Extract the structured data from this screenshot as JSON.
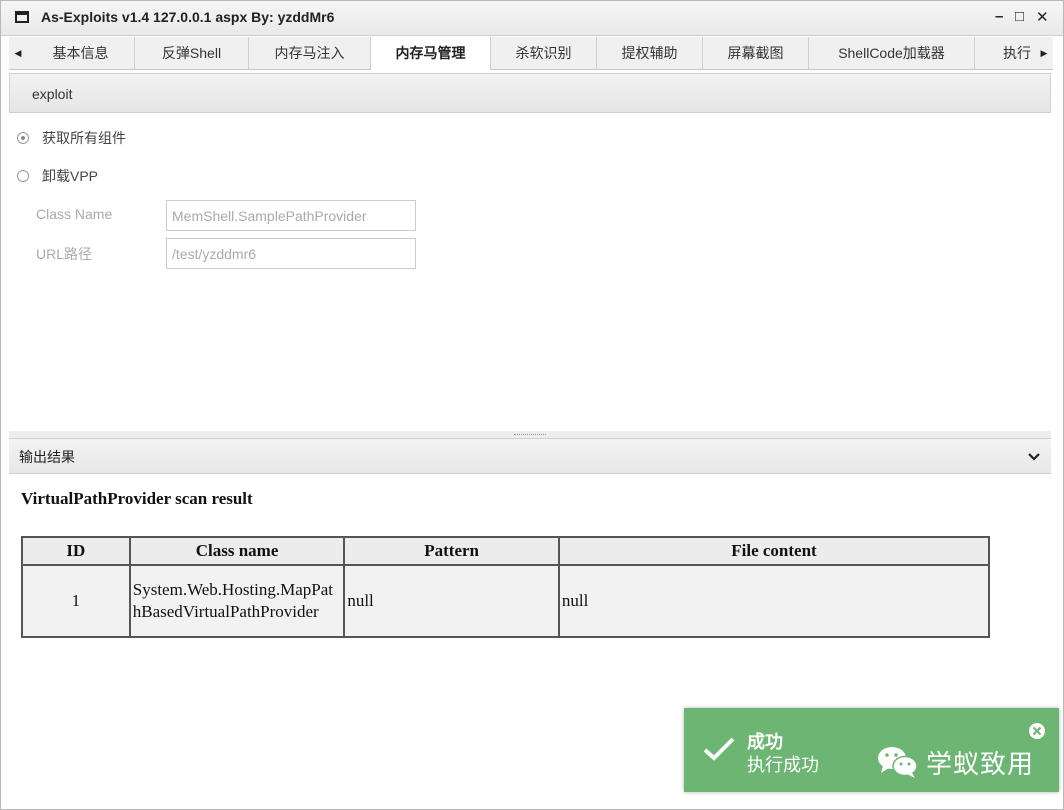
{
  "window": {
    "title": "As-Exploits v1.4 127.0.0.1 aspx By: yzddMr6",
    "minimize": "–",
    "maximize": "□",
    "close": "✕"
  },
  "tabs": [
    {
      "label": "基本信息"
    },
    {
      "label": "反弹Shell"
    },
    {
      "label": "内存马注入"
    },
    {
      "label": "内存马管理",
      "active": true
    },
    {
      "label": "杀软识别"
    },
    {
      "label": "提权辅助"
    },
    {
      "label": "屏幕截图"
    },
    {
      "label": "ShellCode加载器"
    },
    {
      "label": "执行"
    }
  ],
  "subbar": {
    "label": "exploit"
  },
  "options": {
    "get_all": "获取所有组件",
    "unload": "卸载VPP",
    "selected": "get_all"
  },
  "fields": {
    "class_name_label": "Class Name",
    "class_name_value": "MemShell.SamplePathProvider",
    "url_label": "URL路径",
    "url_value": "/test/yzddmr6"
  },
  "output": {
    "title": "输出结果",
    "scan_title": "VirtualPathProvider scan result",
    "columns": [
      "ID",
      "Class name",
      "Pattern",
      "File content"
    ],
    "rows": [
      [
        "1",
        "System.Web.Hosting.MapPathBasedVirtualPathProvider",
        "null",
        "null"
      ]
    ]
  },
  "toast": {
    "title": "成功",
    "message": "执行成功",
    "color": "#6cb573"
  },
  "watermark": {
    "text": "学蚁致用"
  }
}
